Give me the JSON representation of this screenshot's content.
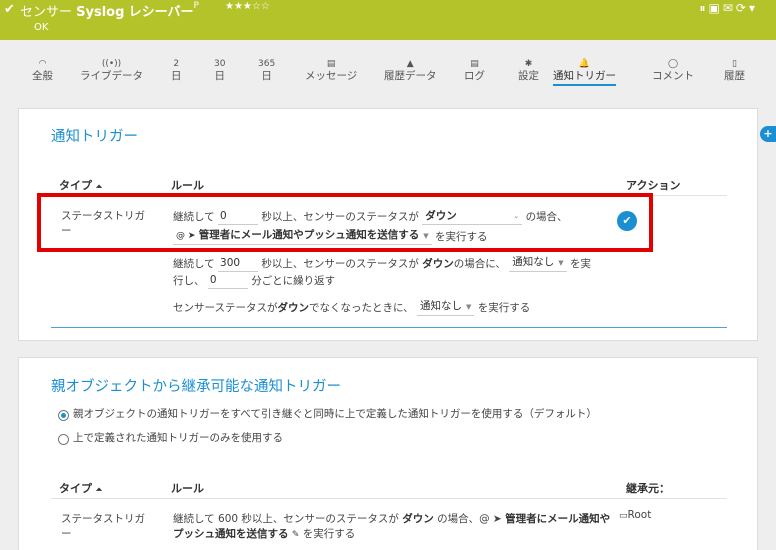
{
  "header": {
    "title_prefix": "センサー",
    "title_bold": "Syslog",
    "title_suffix": "レシーバー",
    "flag": "P",
    "stars": "★★★☆☆",
    "status": "OK",
    "icons": [
      "pause-icon",
      "export-icon",
      "mail-icon",
      "refresh-icon"
    ],
    "icons_text": "⏸▣✉⟳▾"
  },
  "tabs": [
    {
      "icon": "◠",
      "label": "全般"
    },
    {
      "icon": "((•))",
      "label": "ライブデータ"
    },
    {
      "icon": "2",
      "label": "日"
    },
    {
      "icon": "30",
      "label": "日"
    },
    {
      "icon": "365",
      "label": "日"
    },
    {
      "icon": "▤",
      "label": "メッセージ"
    },
    {
      "icon": "▲",
      "label": "履歴データ"
    },
    {
      "icon": "▤",
      "label": "ログ"
    },
    {
      "icon": "✱",
      "label": "設定"
    },
    {
      "icon": "🔔",
      "label": "通知トリガー"
    },
    {
      "icon": "◯",
      "label": "コメント"
    },
    {
      "icon": "▯",
      "label": "履歴"
    }
  ],
  "panel1": {
    "title": "通知トリガー",
    "col_type": "タイプ",
    "sort_icon": "⏶",
    "col_rule": "ルール",
    "col_action": "アクション",
    "row_type_1": "ステータストリガ",
    "row_type_2": "ー",
    "rule1": {
      "t1": "継続して",
      "v1": "0",
      "t2": "秒以上、センサーのステータスが",
      "sel1": "ダウン",
      "t3": "の場合、",
      "notif_prefix": "@ ➤",
      "notif": "管理者にメール通知やプッシュ通知を送信する",
      "t4": "を実行する"
    },
    "rule2": {
      "t1": "継続して",
      "v1": "300",
      "t2": "秒以上、センサーのステータスが",
      "bold": "ダウン",
      "t3": "の場合に、",
      "sel1": "通知なし",
      "t4": "を実",
      "t5": "行し、",
      "v2": "0",
      "t6": "分ごとに繰り返す"
    },
    "rule3": {
      "t1": "センサーステータスが",
      "bold": "ダウン",
      "t2": "でなくなったときに、",
      "sel1": "通知なし",
      "t3": "を実行する"
    }
  },
  "panel2": {
    "title": "親オブジェクトから継承可能な通知トリガー",
    "radio1": "親オブジェクトの通知トリガーをすべて引き継ぐと同時に上で定義した通知トリガーを使用する（デフォルト）",
    "radio2": "上で定義された通知トリガーのみを使用する",
    "col_type": "タイプ",
    "sort_icon": "⏶",
    "col_rule": "ルール",
    "col_inherit": "継承元：",
    "row_type_1": "ステータストリガ",
    "row_type_2": "ー",
    "rule": {
      "t1": "継続して 600 秒以上、センサーのステータスが",
      "bold1": "ダウン",
      "t2": "の場合、@ ➤",
      "bold2": "管理者にメール通知や",
      "bold3": "プッシュ通知を送信する",
      "t3": "を実行する"
    },
    "inherit_from": "Root"
  },
  "colors": {
    "accent": "#1a8fd1",
    "header": "#b4c32a",
    "highlight": "#e30000"
  }
}
